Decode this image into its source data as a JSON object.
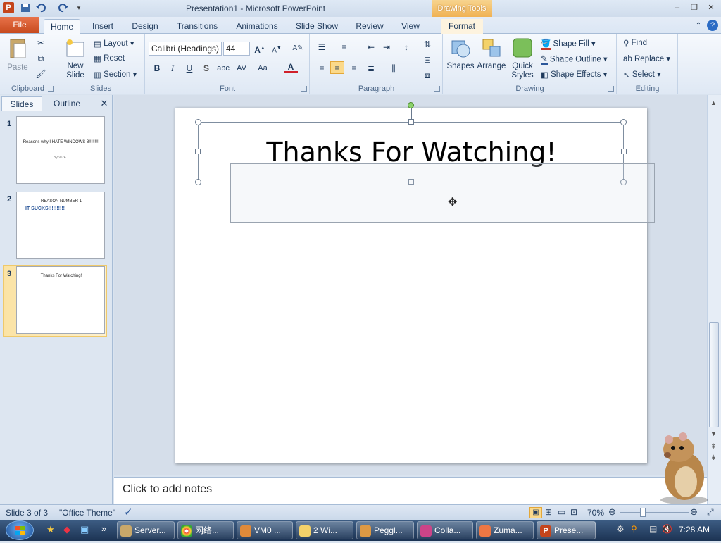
{
  "window": {
    "title": "Presentation1  -  Microsoft PowerPoint",
    "contextual_tab": "Drawing Tools",
    "controls": {
      "minimize": "–",
      "restore": "❐",
      "close": "✕"
    }
  },
  "tabs": {
    "file": "File",
    "items": [
      "Home",
      "Insert",
      "Design",
      "Transitions",
      "Animations",
      "Slide Show",
      "Review",
      "View",
      "Format"
    ]
  },
  "ribbon": {
    "clipboard": {
      "label": "Clipboard",
      "paste": "Paste"
    },
    "slides": {
      "label": "Slides",
      "new_slide": "New Slide",
      "layout": "Layout",
      "reset": "Reset",
      "section": "Section"
    },
    "font": {
      "label": "Font",
      "font_name": "Calibri (Headings)",
      "font_size": "44"
    },
    "paragraph": {
      "label": "Paragraph"
    },
    "drawing": {
      "label": "Drawing",
      "shapes": "Shapes",
      "arrange": "Arrange",
      "quick_styles": "Quick Styles",
      "shape_fill": "Shape Fill",
      "shape_outline": "Shape Outline",
      "shape_effects": "Shape Effects"
    },
    "editing": {
      "label": "Editing",
      "find": "Find",
      "replace": "Replace",
      "select": "Select"
    }
  },
  "pane": {
    "tab_slides": "Slides",
    "tab_outline": "Outline",
    "thumbnails": [
      {
        "num": "1",
        "title": "Reasons why I HATE WINDOWS 8!!!!!!!!!",
        "sub": "By VI2E..."
      },
      {
        "num": "2",
        "title": "REASON NUMBER 1",
        "sub": "IT SUCKS!!!!!!!!!!"
      },
      {
        "num": "3",
        "title": "Thanks For Watching!",
        "sub": ""
      }
    ]
  },
  "slide": {
    "title": "Thanks For Watching!"
  },
  "notes": {
    "placeholder": "Click to add notes"
  },
  "status": {
    "slide": "Slide 3 of 3",
    "theme": "\"Office Theme\"",
    "zoom": "70%",
    "zoom_level": 0.7
  },
  "taskbar": {
    "items": [
      "Server...",
      "网络...",
      "VM0 ...",
      "2 Wi...",
      "Peggl...",
      "Colla...",
      "Zuma...",
      "Prese..."
    ],
    "clock": "7:28 AM"
  },
  "colors": {
    "file_tab": "#d45a2c",
    "contextual": "#f0b254",
    "accent_blue": "#2b579a",
    "taskbar": "#2a4567"
  }
}
